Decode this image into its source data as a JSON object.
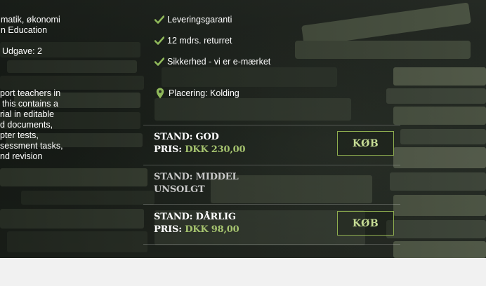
{
  "description_lines": [
    "matik, økonomi",
    "n Education",
    "Udgave: 2",
    "port teachers in",
    "this contains a",
    "rial in editable",
    "d documents,",
    "pter tests,",
    "sessment tasks,",
    "nd revision"
  ],
  "features": [
    {
      "icon": "check-icon",
      "text": "Leveringsgaranti"
    },
    {
      "icon": "check-icon",
      "text": "12 mdrs. returret"
    },
    {
      "icon": "check-icon",
      "text": "Sikkerhed - vi er e-mærket"
    },
    {
      "icon": "map-pin-icon",
      "text": "Placering: Kolding"
    }
  ],
  "conditions": [
    {
      "stand": "STAND: GOD",
      "price_label": "PRIS: ",
      "price_value": "DKK 230,00",
      "button": "KØB",
      "available": true
    },
    {
      "stand": "STAND: MIDDEL",
      "status": "UNSOLGT",
      "available": false
    },
    {
      "stand": "STAND: DÅRLIG",
      "price_label": "PRIS: ",
      "price_value": "DKK 98,00",
      "button": "KØB",
      "available": true
    }
  ],
  "colors": {
    "accent": "#a6c46f",
    "button_border": "#8fae4f",
    "check": "#8fb85a",
    "bottom_bar": "#f1f1f1"
  }
}
